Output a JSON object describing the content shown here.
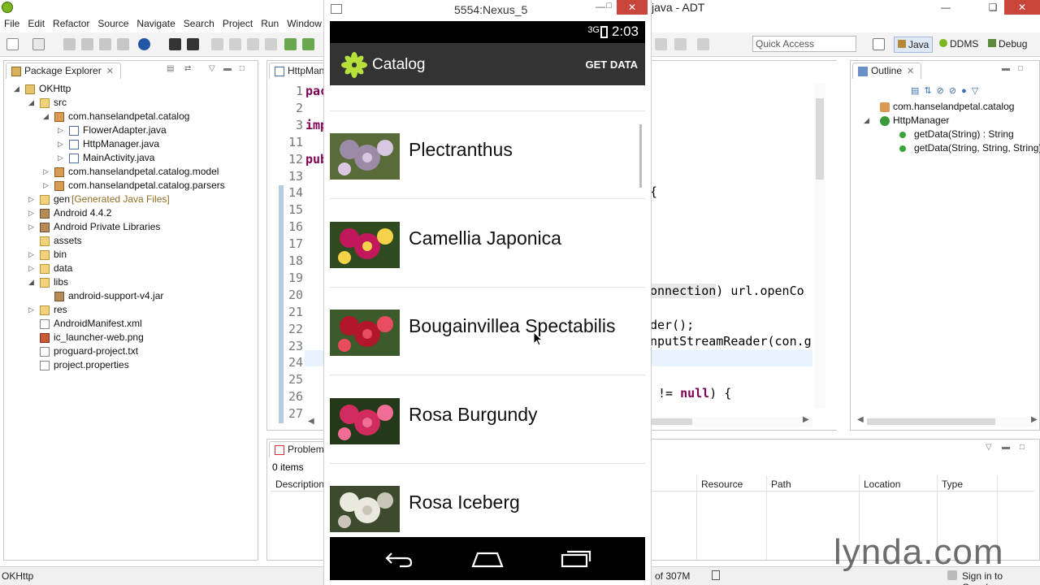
{
  "window": {
    "title": "java - ADT",
    "menu": [
      "File",
      "Edit",
      "Refactor",
      "Source",
      "Navigate",
      "Search",
      "Project",
      "Run",
      "Window"
    ]
  },
  "toolbar": {
    "quick_access_placeholder": "Quick Access",
    "perspectives": [
      "Java",
      "DDMS",
      "Debug"
    ]
  },
  "package_explorer": {
    "tab_label": "Package Explorer",
    "tree": [
      {
        "label": "OKHttp",
        "icon": "project-icon",
        "level": 0,
        "expand": "open"
      },
      {
        "label": "src",
        "icon": "folder-icon",
        "level": 1,
        "expand": "open"
      },
      {
        "label": "com.hanselandpetal.catalog",
        "icon": "package-icon",
        "level": 2,
        "expand": "open"
      },
      {
        "label": "FlowerAdapter.java",
        "icon": "java-file-icon",
        "level": 3,
        "expand": "closed"
      },
      {
        "label": "HttpManager.java",
        "icon": "java-file-icon",
        "level": 3,
        "expand": "closed"
      },
      {
        "label": "MainActivity.java",
        "icon": "java-file-icon",
        "level": 3,
        "expand": "closed"
      },
      {
        "label": "com.hanselandpetal.catalog.model",
        "icon": "package-icon",
        "level": 2,
        "expand": "closed"
      },
      {
        "label": "com.hanselandpetal.catalog.parsers",
        "icon": "package-icon",
        "level": 2,
        "expand": "closed"
      },
      {
        "label": "gen",
        "suffix": "[Generated Java Files]",
        "icon": "folder-icon",
        "level": 1,
        "expand": "closed"
      },
      {
        "label": "Android 4.4.2",
        "icon": "library-icon",
        "level": 1,
        "expand": "closed"
      },
      {
        "label": "Android Private Libraries",
        "icon": "library-icon",
        "level": 1,
        "expand": "closed"
      },
      {
        "label": "assets",
        "icon": "folder-icon",
        "level": 1,
        "expand": "none"
      },
      {
        "label": "bin",
        "icon": "folder-icon",
        "level": 1,
        "expand": "closed"
      },
      {
        "label": "data",
        "icon": "folder-icon",
        "level": 1,
        "expand": "closed"
      },
      {
        "label": "libs",
        "icon": "folder-icon",
        "level": 1,
        "expand": "open"
      },
      {
        "label": "android-support-v4.jar",
        "icon": "jar-icon",
        "level": 2,
        "expand": "none"
      },
      {
        "label": "res",
        "icon": "folder-icon",
        "level": 1,
        "expand": "closed"
      },
      {
        "label": "AndroidManifest.xml",
        "icon": "xml-file-icon",
        "level": 1,
        "expand": "none"
      },
      {
        "label": "ic_launcher-web.png",
        "icon": "image-file-icon",
        "level": 1,
        "expand": "none"
      },
      {
        "label": "proguard-project.txt",
        "icon": "text-file-icon",
        "level": 1,
        "expand": "none"
      },
      {
        "label": "project.properties",
        "icon": "text-file-icon",
        "level": 1,
        "expand": "none"
      }
    ]
  },
  "editor": {
    "tab_label": "HttpMana",
    "line_numbers": [
      "1",
      "2",
      "3",
      "11",
      "12",
      "13",
      "14",
      "15",
      "16",
      "17",
      "18",
      "19",
      "20",
      "21",
      "22",
      "23",
      "24",
      "25",
      "26",
      "27"
    ],
    "code_left": [
      "pac",
      "imp",
      "pub"
    ],
    "code_right": [
      "{",
      "onnection",
      ") url.openCo",
      "der();",
      "nputStreamReader(con.g",
      "!=",
      "null",
      ") {"
    ]
  },
  "outline": {
    "tab_label": "Outline",
    "items": [
      {
        "label": "com.hanselandpetal.catalog",
        "icon": "package-icon",
        "level": 0
      },
      {
        "label": "HttpManager",
        "icon": "class-icon",
        "level": 0
      },
      {
        "label": "getData(String) : String",
        "icon": "method-icon",
        "level": 1
      },
      {
        "label": "getData(String, String, String)",
        "icon": "method-icon",
        "level": 1
      }
    ]
  },
  "problems": {
    "tab_label": "Problems",
    "count": "0 items",
    "columns": [
      "Description",
      "Resource",
      "Path",
      "Location",
      "Type"
    ]
  },
  "status": {
    "left": "OKHttp",
    "memory": "of 307M",
    "sign_in": "Sign in to Google..."
  },
  "emulator": {
    "window_title": "5554:Nexus_5",
    "status_time": "2:03",
    "status_network": "3G",
    "app_title": "Catalog",
    "action_label": "GET DATA",
    "flowers": [
      {
        "name": "Plectranthus",
        "colors": [
          "#9c8ba6",
          "#d8c7e0",
          "#5a6b3a"
        ]
      },
      {
        "name": "Camellia Japonica",
        "colors": [
          "#c2185b",
          "#f4d34a",
          "#2f4a1f"
        ]
      },
      {
        "name": "Bougainvillea Spectabilis",
        "colors": [
          "#b1162a",
          "#e84c5e",
          "#3c5a2a"
        ]
      },
      {
        "name": "Rosa Burgundy",
        "colors": [
          "#d12b5f",
          "#f06d95",
          "#24391a"
        ]
      },
      {
        "name": "Rosa Iceberg",
        "colors": [
          "#ebe8df",
          "#c9c5b8",
          "#3d4a2e"
        ]
      }
    ]
  },
  "watermark": "lynda.com"
}
